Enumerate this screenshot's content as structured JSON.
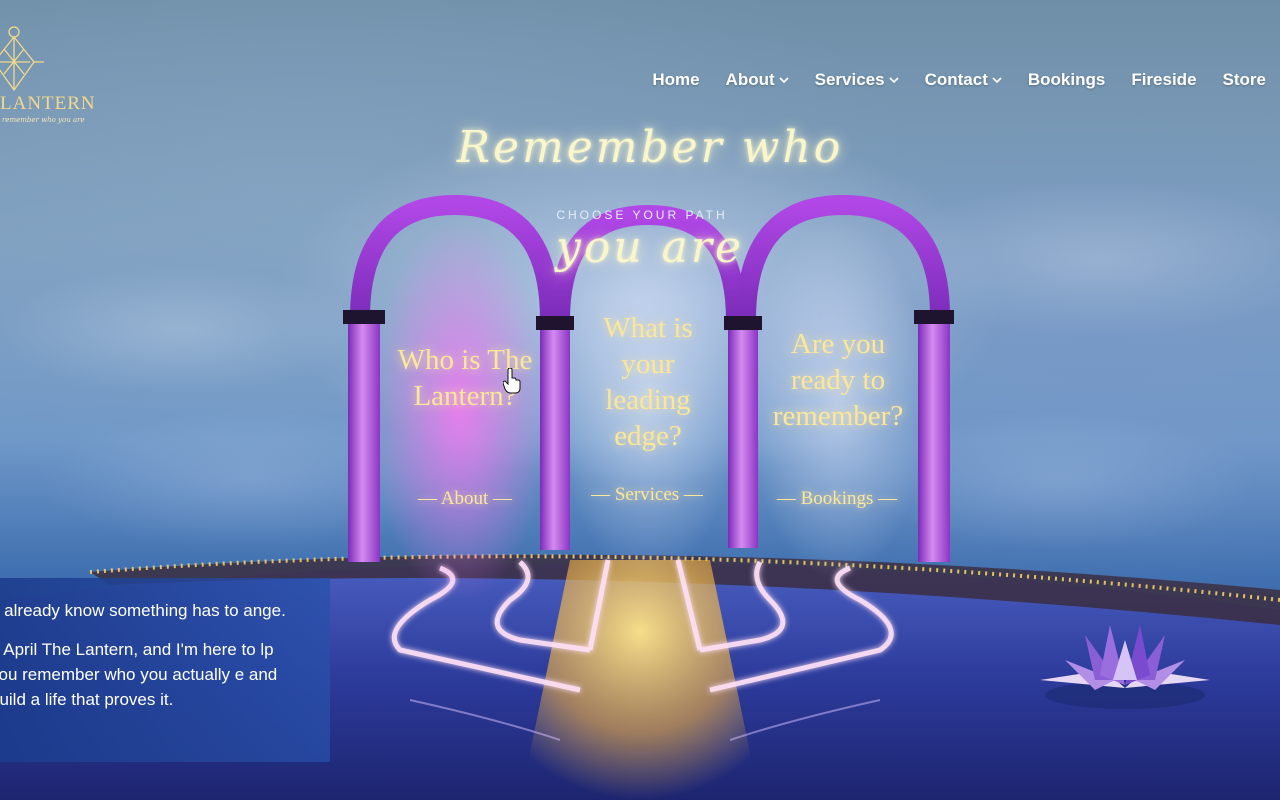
{
  "brand": {
    "name": "LANTERN",
    "tagline": "remember who you are"
  },
  "nav": {
    "items": [
      {
        "label": "Home",
        "dropdown": false
      },
      {
        "label": "About",
        "dropdown": true
      },
      {
        "label": "Services",
        "dropdown": true
      },
      {
        "label": "Contact",
        "dropdown": true
      },
      {
        "label": "Bookings",
        "dropdown": false
      },
      {
        "label": "Fireside",
        "dropdown": false
      },
      {
        "label": "Store",
        "dropdown": false
      }
    ]
  },
  "hero": {
    "headline": "Remember who you are",
    "subhead": "CHOOSE YOUR PATH"
  },
  "doors": [
    {
      "title_lines": [
        "Who is The",
        "Lantern?"
      ],
      "link": "— About —"
    },
    {
      "title_lines": [
        "What is",
        "your",
        "leading",
        "edge?"
      ],
      "link": "— Services —"
    },
    {
      "title_lines": [
        "Are you",
        "ready to",
        "remember?"
      ],
      "link": "— Bookings —"
    }
  ],
  "intro": {
    "paragraph1": "u already know something has to ange.",
    "paragraph2": "n April The Lantern, and I'm here to lp you remember who you actually e and build a life that proves it."
  },
  "colors": {
    "accent_gold": "#fbe69a",
    "arch_purple": "#a63fd8",
    "neon_pink": "#ffd0f0",
    "panel_blue": "#1c3c8c"
  },
  "icons": {
    "cursor": "hand-pointer-icon",
    "logo": "lantern-logo-icon",
    "lotus": "lotus-flower"
  }
}
